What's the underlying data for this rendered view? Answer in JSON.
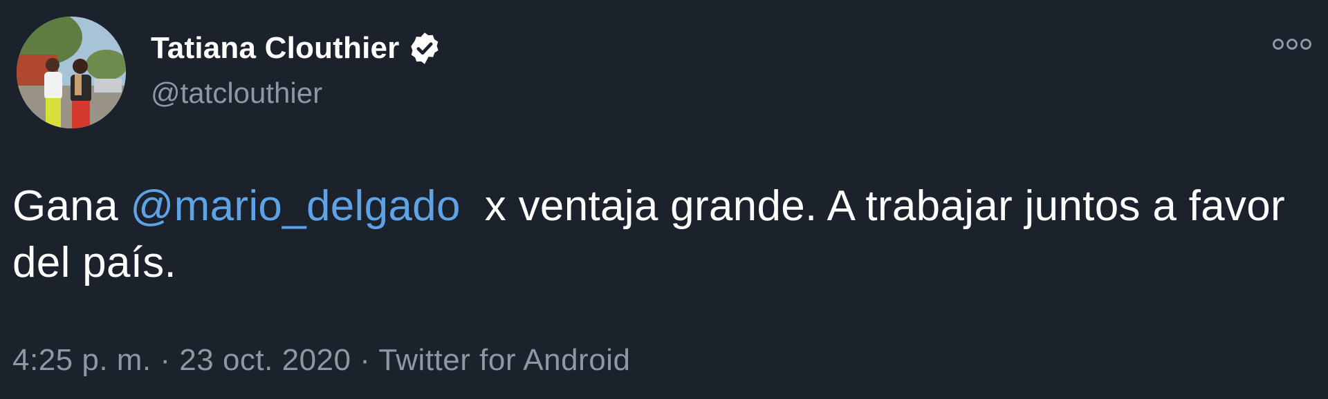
{
  "author": {
    "display_name": "Tatiana Clouthier",
    "handle": "@tatclouthier",
    "verified": true
  },
  "tweet": {
    "text_before_mention": "Gana ",
    "mention": "@mario_delgado",
    "text_after_mention": "  x ventaja grande. A trabajar juntos a favor del país.",
    "time": "4:25 p. m.",
    "separator": "·",
    "date": "23 oct. 2020",
    "source": "Twitter for Android"
  },
  "icons": {
    "verified": "verified-badge-icon",
    "more": "more-options-icon"
  },
  "colors": {
    "background": "#1c222c",
    "text": "#ffffff",
    "secondary_text": "#8e97a3",
    "link": "#5ea3e6"
  }
}
